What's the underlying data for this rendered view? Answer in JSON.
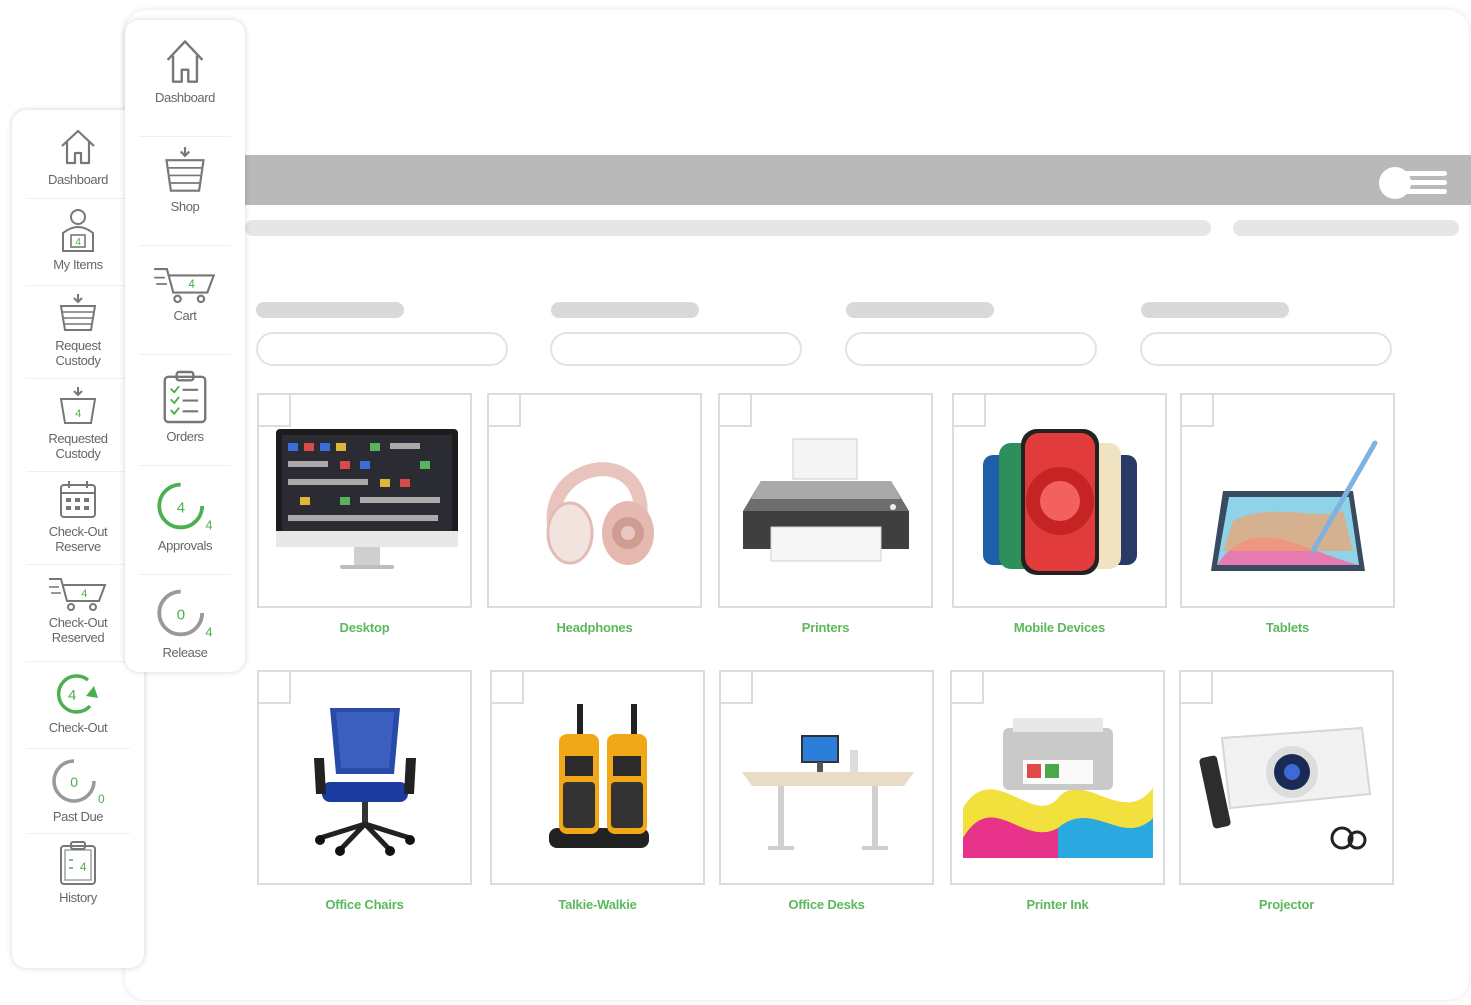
{
  "colors": {
    "accent_green": "#5cb85c",
    "topbar_gray": "#b9b9b9",
    "skeleton_gray": "#e6e6e6"
  },
  "sidebar_outer": {
    "items": [
      {
        "label": "Dashboard",
        "icon": "house-icon"
      },
      {
        "label": "My Items",
        "icon": "user-box-icon",
        "badge": "4"
      },
      {
        "label": "Request Custody",
        "icon": "basket-icon"
      },
      {
        "label": "Requested Custody",
        "icon": "basket-icon",
        "badge": "4"
      },
      {
        "label": "Check-Out Reserve",
        "icon": "calendar-icon"
      },
      {
        "label": "Check-Out Reserved",
        "icon": "cart-icon",
        "badge": "4"
      },
      {
        "label": "Check-Out",
        "icon": "refresh-arrow-icon",
        "badge": "4"
      },
      {
        "label": "Past Due",
        "icon": "progress-ring-icon",
        "badge": "0",
        "sub": "0"
      },
      {
        "label": "History",
        "icon": "clipboard-icon",
        "badge": "4"
      }
    ]
  },
  "sidebar_inner": {
    "items": [
      {
        "label": "Dashboard",
        "icon": "house-icon"
      },
      {
        "label": "Shop",
        "icon": "basket-icon"
      },
      {
        "label": "Cart",
        "icon": "cart-icon",
        "badge": "4"
      },
      {
        "label": "Orders",
        "icon": "clipboard-list-icon"
      },
      {
        "label": "Approvals",
        "icon": "progress-ring-icon",
        "badge": "4",
        "sub": "4"
      },
      {
        "label": "Release",
        "icon": "progress-ring-icon",
        "badge": "0",
        "sub": "4"
      }
    ]
  },
  "products": [
    {
      "label": "Desktop",
      "icon": "monitor-icon"
    },
    {
      "label": "Headphones",
      "icon": "headphones-icon"
    },
    {
      "label": "Printers",
      "icon": "printer-icon"
    },
    {
      "label": "Mobile Devices",
      "icon": "phone-icon"
    },
    {
      "label": "Tablets",
      "icon": "tablet-icon"
    },
    {
      "label": "Office Chairs",
      "icon": "chair-icon"
    },
    {
      "label": "Talkie-Walkie",
      "icon": "walkie-talkie-icon"
    },
    {
      "label": "Office Desks",
      "icon": "desk-icon"
    },
    {
      "label": "Printer Ink",
      "icon": "ink-printer-icon"
    },
    {
      "label": "Projector",
      "icon": "projector-icon"
    }
  ]
}
